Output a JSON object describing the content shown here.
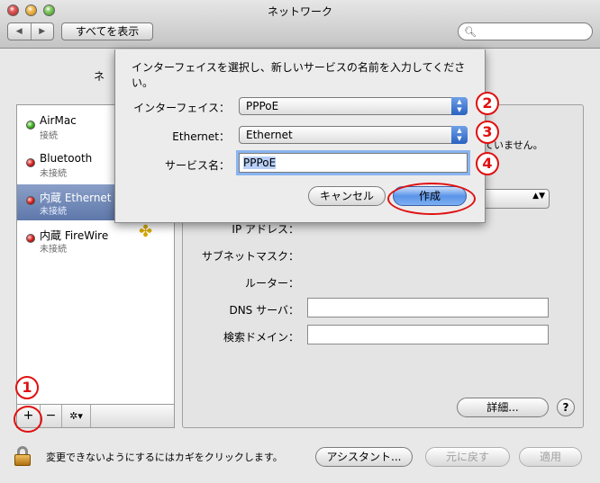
{
  "window": {
    "title": "ネットワーク"
  },
  "toolbar": {
    "back": "◀",
    "forward": "▶",
    "show_all": "すべてを表示",
    "search_placeholder": ""
  },
  "location_label_partial": "ネ",
  "services": [
    {
      "name": "AirMac",
      "status": "接続",
      "color": "green",
      "selected": false
    },
    {
      "name": "Bluetooth",
      "status": "未接続",
      "color": "red",
      "selected": false
    },
    {
      "name": "内蔵 Ethernet",
      "status": "未接続",
      "color": "red",
      "selected": true
    },
    {
      "name": "内蔵 FireWire",
      "status": "未接続",
      "color": "red",
      "selected": false
    }
  ],
  "sidebar_controls": {
    "add": "+",
    "remove": "−",
    "action": "✲▾"
  },
  "main": {
    "partial_status": "ていません。",
    "labels": {
      "ip": "IP アドレス：",
      "subnet": "サブネットマスク：",
      "router": "ルーター：",
      "dns": "DNS サーバ：",
      "search_domain": "検索ドメイン："
    },
    "advanced_button": "詳細...",
    "help_button": "?"
  },
  "bottom": {
    "lock_text": "変更できないようにするにはカギをクリックします。",
    "assistant_button": "アシスタント...",
    "revert_button": "元に戻す",
    "apply_button": "適用"
  },
  "sheet": {
    "prompt": "インターフェイスを選択し、新しいサービスの名前を入力してください。",
    "interface_label": "インターフェイス：",
    "interface_value": "PPPoE",
    "ethernet_label": "Ethernet：",
    "ethernet_value": "Ethernet",
    "service_name_label": "サービス名：",
    "service_name_value": "PPPoE",
    "cancel_button": "キャンセル",
    "create_button": "作成"
  },
  "annotations": {
    "n1": "1",
    "n2": "2",
    "n3": "3",
    "n4": "4"
  },
  "colors": {
    "annotation": "#e01010",
    "selection": "#5e78aa",
    "default_button": "#5b94e8"
  }
}
